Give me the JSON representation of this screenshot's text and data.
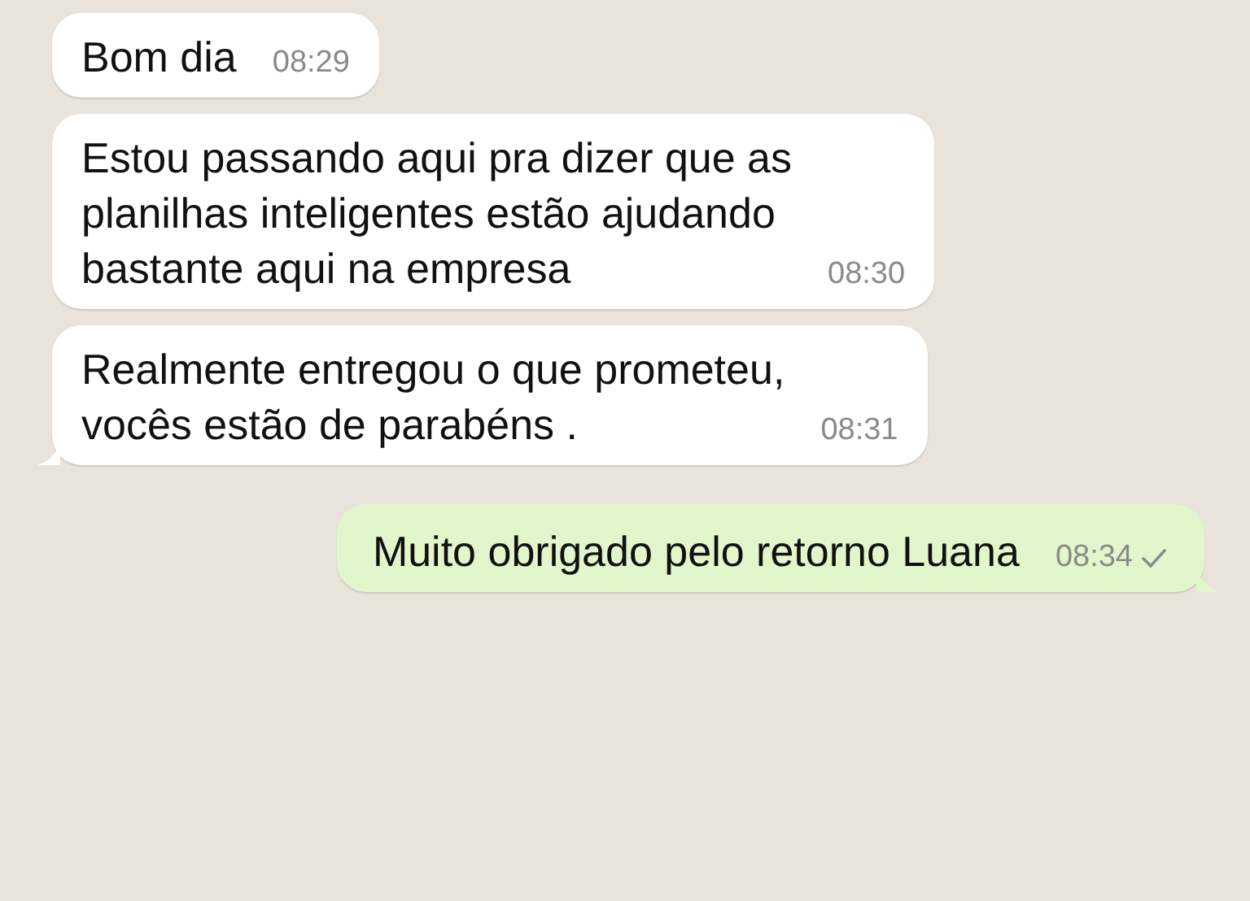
{
  "messages": [
    {
      "outgoing": false,
      "text": "Bom dia",
      "time": "08:29",
      "tail": false
    },
    {
      "outgoing": false,
      "text": "Estou passando aqui pra dizer que as\nplanilhas inteligentes estão ajudando\nbastante aqui na empresa",
      "time": "08:30",
      "tail": false
    },
    {
      "outgoing": false,
      "text": "Realmente entregou o que prometeu,\nvocês estão de parabéns .",
      "time": "08:31",
      "tail": true
    },
    {
      "outgoing": true,
      "text": "Muito obrigado pelo retorno Luana",
      "time": "08:34",
      "tail": true,
      "sent": true
    }
  ]
}
